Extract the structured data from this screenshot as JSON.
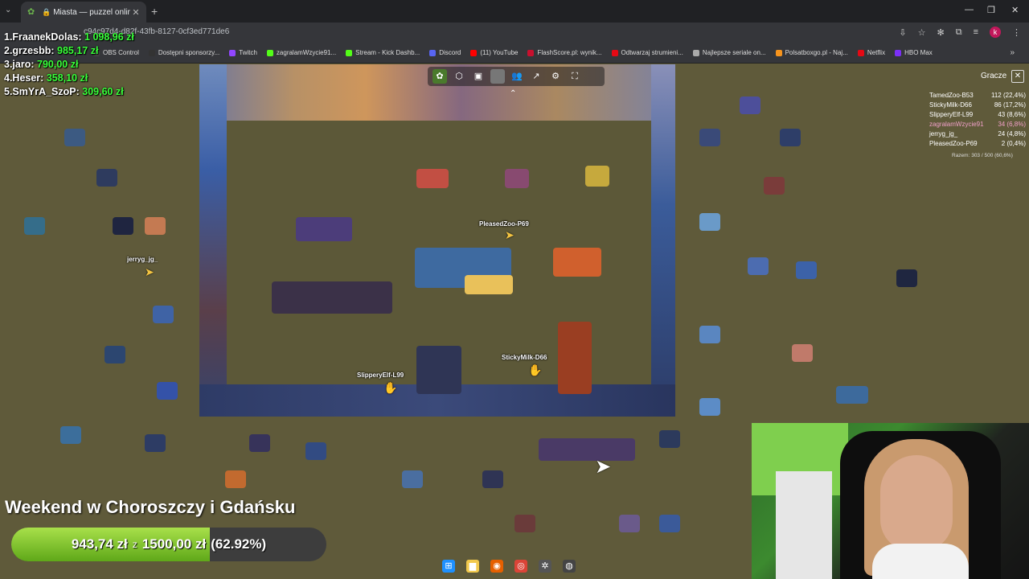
{
  "browser": {
    "tab_title": "Miasta — puzzel online",
    "url": "c94c97d4-d82f-43fb-8127-0cf3ed771de6",
    "bookmarks": [
      {
        "label": "OBS Control",
        "color": "#444"
      },
      {
        "label": "Dostępni sponsorzy...",
        "color": "#333"
      },
      {
        "label": "Twitch",
        "color": "#9146ff"
      },
      {
        "label": "zagralamWzycie91...",
        "color": "#53fc18"
      },
      {
        "label": "Stream - Kick Dashb...",
        "color": "#53fc18"
      },
      {
        "label": "Discord",
        "color": "#5865f2"
      },
      {
        "label": "(11) YouTube",
        "color": "#ff0000"
      },
      {
        "label": "FlashScore.pl: wynik...",
        "color": "#c8102e"
      },
      {
        "label": "Odtwarzaj strumieni...",
        "color": "#e50914"
      },
      {
        "label": "Najlepsze seriale on...",
        "color": "#aaa"
      },
      {
        "label": "Polsatboxgo.pl - Naj...",
        "color": "#f7941d"
      },
      {
        "label": "Netflix",
        "color": "#e50914"
      },
      {
        "label": "HBO Max",
        "color": "#7b2ff7"
      }
    ]
  },
  "leaderboard": [
    {
      "name": "1.FraanekDolas:",
      "amount": "1 098,96 zł"
    },
    {
      "name": "2.grzesbb:",
      "amount": "985,17 zł"
    },
    {
      "name": "3.jaro:",
      "amount": "790,00 zł"
    },
    {
      "name": "4.Heser:",
      "amount": "358,10 zł"
    },
    {
      "name": "5.SmYrA_SzoP:",
      "amount": "309,60 zł"
    }
  ],
  "players_panel": {
    "title": "Gracze",
    "players": [
      {
        "name": "TamedZoo-B53",
        "score": "112 (22,4%)"
      },
      {
        "name": "StickyMilk-D66",
        "score": "86 (17,2%)"
      },
      {
        "name": "SlipperyElf-L99",
        "score": "43 (8,6%)"
      },
      {
        "name": "zagralamWzycie91",
        "score": "34 (6,8%)"
      },
      {
        "name": "jerryg_jg_",
        "score": "24 (4,8%)"
      },
      {
        "name": "PleasedZoo-P69",
        "score": "2 (0,4%)"
      }
    ],
    "total": "Razem: 303 / 500 (60,6%)"
  },
  "cursors": [
    {
      "label": "PleasedZoo-P69"
    },
    {
      "label": "jerryg_jg_"
    },
    {
      "label": "StickyMilk-D66"
    },
    {
      "label": "SlipperyElf-L99"
    }
  ],
  "goal": {
    "title": "Weekend w Choroszczy i Gdańsku",
    "current": "943,74 zł",
    "of": "z",
    "target": "1500,00 zł",
    "percent": "(62.92%)",
    "fraction": 0.6292
  },
  "colors": {
    "accent_green": "#39ff3a",
    "background": "#5f5a3a"
  }
}
